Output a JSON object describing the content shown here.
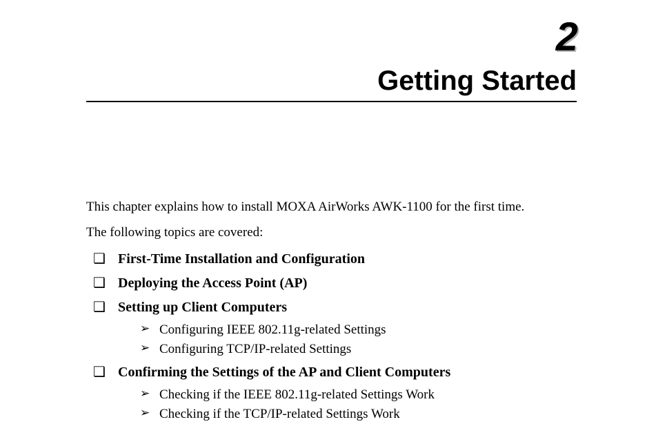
{
  "chapter": {
    "number": "2",
    "title": "Getting Started"
  },
  "intro": {
    "line1": "This chapter explains how to install MOXA AirWorks AWK-1100 for the first time.",
    "line2": "The following topics are covered:"
  },
  "topics": [
    {
      "label": "First-Time Installation and Configuration",
      "sub": []
    },
    {
      "label": "Deploying the Access Point (AP)",
      "sub": []
    },
    {
      "label": "Setting up Client Computers",
      "sub": [
        "Configuring IEEE 802.11g-related Settings",
        "Configuring TCP/IP-related Settings"
      ]
    },
    {
      "label": "Confirming the Settings of the AP and Client Computers",
      "sub": [
        "Checking if the IEEE 802.11g-related Settings Work",
        "Checking if the TCP/IP-related Settings Work"
      ]
    }
  ]
}
